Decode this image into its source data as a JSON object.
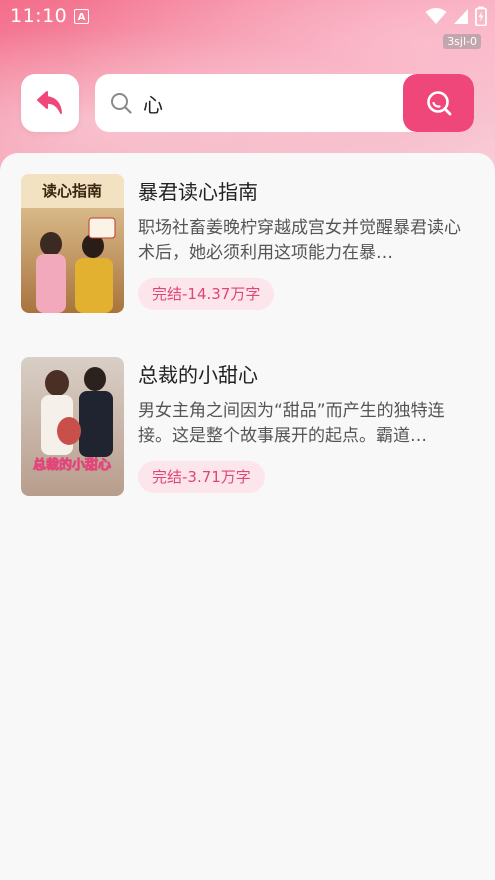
{
  "status": {
    "time": "11:10",
    "a_icon": "A",
    "corner_tag": "3sjl-0"
  },
  "header": {
    "back_icon": "back-arrow-icon",
    "search_icon": "search-icon",
    "search_value": "心",
    "search_button_icon": "search-icon"
  },
  "colors": {
    "accent": "#f0477a",
    "badge_bg": "#fce6ec",
    "badge_text": "#e0457a"
  },
  "books": [
    {
      "title": "暴君读心指南",
      "description": "职场社畜姜晚柠穿越成宫女并觉醒暴君读心术后，她必须利用这项能力在暴…",
      "badge": "完结-14.37万字",
      "cover_text": "读心指南"
    },
    {
      "title": "总裁的小甜心",
      "description": "男女主角之间因为“甜品”而产生的独特连接。这是整个故事展开的起点。霸道…",
      "badge": "完结-3.71万字",
      "cover_text": "总裁的小甜心"
    }
  ]
}
